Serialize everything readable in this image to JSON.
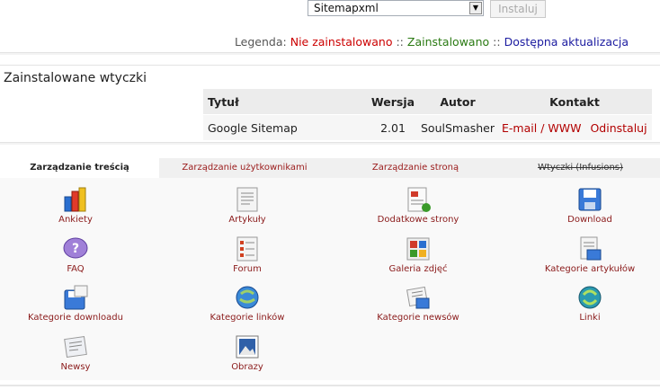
{
  "top": {
    "select_value": "Sitemapxml",
    "install_button": "Instaluj"
  },
  "legend": {
    "label": "Legenda:",
    "not_installed": "Nie zainstalowano",
    "installed": "Zainstalowano",
    "update": "Dostępna aktualizacja",
    "separator": "::",
    "colors": {
      "not_installed": "#cc0000",
      "installed": "#2a7a12",
      "update": "#1b1ba0"
    }
  },
  "installed": {
    "title": "Zainstalowane wtyczki",
    "headers": {
      "title": "Tytuł",
      "version": "Wersja",
      "author": "Autor",
      "contact": "Kontakt"
    },
    "rows": [
      {
        "title": "Google Sitemap",
        "version": "2.01",
        "author": "SoulSmasher",
        "email": "E-mail",
        "slash": "/",
        "www": "WWW",
        "uninstall": "Odinstaluj"
      }
    ]
  },
  "tabs": [
    {
      "label": "Zarządzanie treścią",
      "active": true
    },
    {
      "label": "Zarządzanie użytkownikami",
      "active": false
    },
    {
      "label": "Zarządzanie stroną",
      "active": false
    },
    {
      "label": "Wtyczki (Infusions)",
      "active": false
    }
  ],
  "items": [
    {
      "label": "Ankiety",
      "icon": "poll-icon"
    },
    {
      "label": "Artykuły",
      "icon": "articles-icon"
    },
    {
      "label": "Dodatkowe strony",
      "icon": "custom-pages-icon"
    },
    {
      "label": "Download",
      "icon": "download-icon"
    },
    {
      "label": "FAQ",
      "icon": "faq-icon"
    },
    {
      "label": "Forum",
      "icon": "forum-icon"
    },
    {
      "label": "Galeria zdjęć",
      "icon": "photo-gallery-icon"
    },
    {
      "label": "Kategorie artykułów",
      "icon": "article-categories-icon"
    },
    {
      "label": "Kategorie downloadu",
      "icon": "download-categories-icon"
    },
    {
      "label": "Kategorie linków",
      "icon": "link-categories-icon"
    },
    {
      "label": "Kategorie newsów",
      "icon": "news-categories-icon"
    },
    {
      "label": "Linki",
      "icon": "links-icon"
    },
    {
      "label": "Newsy",
      "icon": "news-icon"
    },
    {
      "label": "Obrazy",
      "icon": "images-icon"
    }
  ]
}
